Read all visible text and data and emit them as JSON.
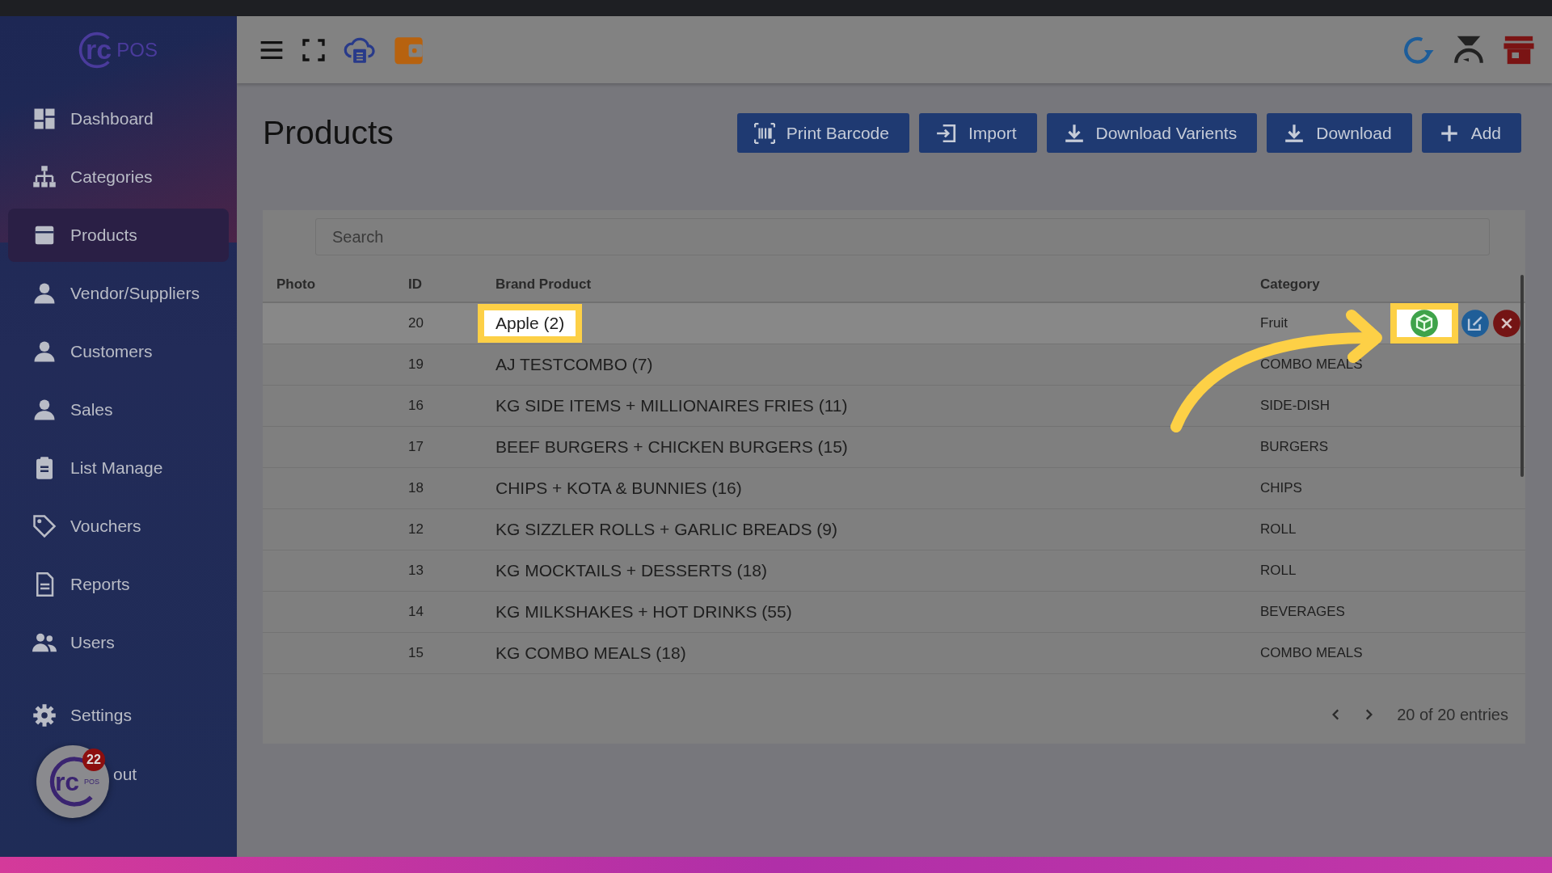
{
  "logo": {
    "mark": "rc",
    "text": "POS"
  },
  "sidebar": {
    "items": [
      {
        "label": "Dashboard",
        "selected": false
      },
      {
        "label": "Categories",
        "selected": false
      },
      {
        "label": "Products",
        "selected": true
      },
      {
        "label": "Vendor/Suppliers",
        "selected": false
      },
      {
        "label": "Customers",
        "selected": false
      },
      {
        "label": "Sales",
        "selected": false
      },
      {
        "label": "List Manage",
        "selected": false
      },
      {
        "label": "Vouchers",
        "selected": false
      },
      {
        "label": "Reports",
        "selected": false
      },
      {
        "label": "Users",
        "selected": false
      }
    ],
    "bottom_items": [
      {
        "label": "Settings",
        "kind": "link"
      },
      {
        "label": "out",
        "kind": "covered"
      }
    ]
  },
  "floating_widget": {
    "mark": "rc",
    "sub": "POS",
    "badge": "22"
  },
  "page": {
    "title": "Products"
  },
  "buttons": [
    {
      "label": "Print Barcode"
    },
    {
      "label": "Import"
    },
    {
      "label": "Download Varients"
    },
    {
      "label": "Download"
    },
    {
      "label": "Add"
    }
  ],
  "search": {
    "placeholder": "Search"
  },
  "table": {
    "columns": [
      "Photo",
      "ID",
      "Brand Product",
      "Category"
    ],
    "rows": [
      {
        "id": "20",
        "product": "Apple (2)",
        "category": "Fruit",
        "hovered": true,
        "name_highlighted": true,
        "action_highlighted": true
      },
      {
        "id": "19",
        "product": "AJ TESTCOMBO (7)",
        "category": "COMBO MEALS",
        "hovered": false,
        "name_highlighted": false,
        "action_highlighted": false
      },
      {
        "id": "16",
        "product": "KG SIDE ITEMS + MILLIONAIRES FRIES (11)",
        "category": "SIDE-DISH",
        "hovered": false,
        "name_highlighted": false,
        "action_highlighted": false
      },
      {
        "id": "17",
        "product": "BEEF BURGERS + CHICKEN BURGERS (15)",
        "category": "BURGERS",
        "hovered": false,
        "name_highlighted": false,
        "action_highlighted": false
      },
      {
        "id": "18",
        "product": "CHIPS + KOTA & BUNNIES (16)",
        "category": "CHIPS",
        "hovered": false,
        "name_highlighted": false,
        "action_highlighted": false
      },
      {
        "id": "12",
        "product": "KG SIZZLER ROLLS + GARLIC BREADS (9)",
        "category": "ROLL",
        "hovered": false,
        "name_highlighted": false,
        "action_highlighted": false
      },
      {
        "id": "13",
        "product": "KG MOCKTAILS + DESSERTS (18)",
        "category": "ROLL",
        "hovered": false,
        "name_highlighted": false,
        "action_highlighted": false
      },
      {
        "id": "14",
        "product": "KG MILKSHAKES + HOT DRINKS (55)",
        "category": "BEVERAGES",
        "hovered": false,
        "name_highlighted": false,
        "action_highlighted": false
      },
      {
        "id": "15",
        "product": "KG COMBO MEALS (18)",
        "category": "COMBO MEALS",
        "hovered": false,
        "name_highlighted": false,
        "action_highlighted": false
      }
    ]
  },
  "pagination": {
    "summary": "20 of 20 entries"
  }
}
